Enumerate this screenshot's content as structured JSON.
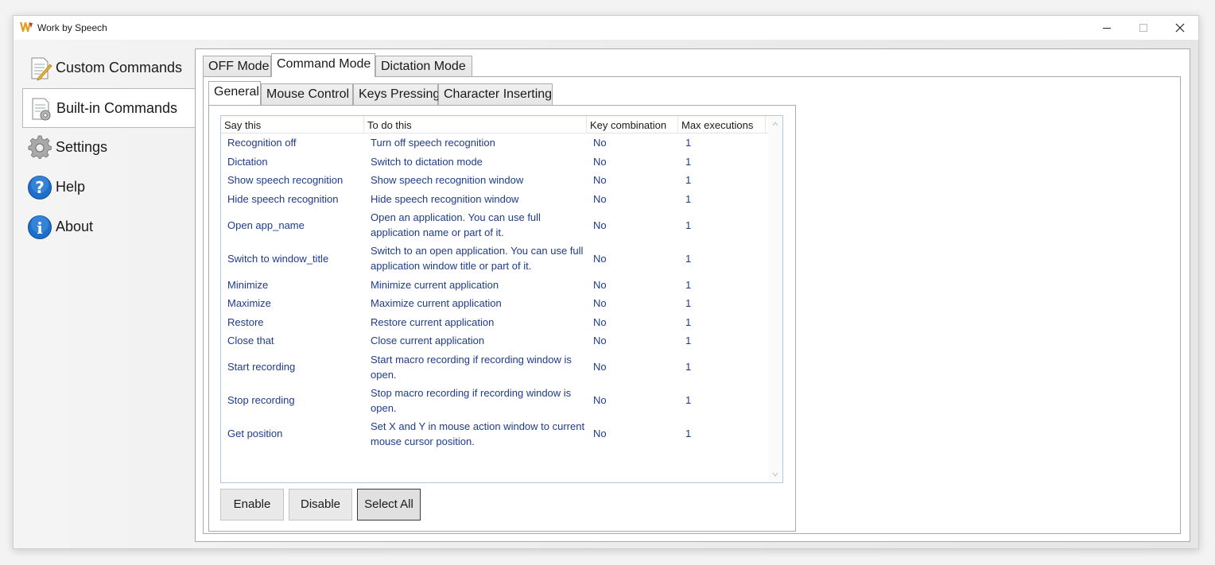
{
  "window": {
    "title": "Work by Speech"
  },
  "sidebar": {
    "items": [
      {
        "label": "Custom Commands",
        "icon": "document-pencil-icon"
      },
      {
        "label": "Built-in Commands",
        "icon": "document-gear-icon",
        "selected": true
      },
      {
        "label": "Settings",
        "icon": "gear-icon"
      },
      {
        "label": "Help",
        "icon": "help-icon"
      },
      {
        "label": "About",
        "icon": "info-icon"
      }
    ]
  },
  "mode_tabs": [
    {
      "label": "OFF Mode"
    },
    {
      "label": "Command Mode",
      "active": true
    },
    {
      "label": "Dictation Mode"
    }
  ],
  "sub_tabs": [
    {
      "label": "General",
      "active": true
    },
    {
      "label": "Mouse Control"
    },
    {
      "label": "Keys Pressing"
    },
    {
      "label": "Character Inserting"
    }
  ],
  "table": {
    "columns": [
      "Say this",
      "To do this",
      "Key combination",
      "Max executions"
    ],
    "rows": [
      {
        "say": "Recognition off",
        "do": "Turn off speech recognition",
        "key": "No",
        "max": "1"
      },
      {
        "say": "Dictation",
        "do": "Switch to dictation mode",
        "key": "No",
        "max": "1"
      },
      {
        "say": "Show speech recognition",
        "do": "Show speech recognition window",
        "key": "No",
        "max": "1"
      },
      {
        "say": "Hide speech recognition",
        "do": "Hide speech recognition window",
        "key": "No",
        "max": "1"
      },
      {
        "say": "Open app_name",
        "do": "Open an application. You can use full application name or part of it.",
        "key": "No",
        "max": "1"
      },
      {
        "say": "Switch to window_title",
        "do": "Switch to an open application. You can use full application window title or part of it.",
        "key": "No",
        "max": "1"
      },
      {
        "say": "Minimize",
        "do": "Minimize current application",
        "key": "No",
        "max": "1"
      },
      {
        "say": "Maximize",
        "do": "Maximize current application",
        "key": "No",
        "max": "1"
      },
      {
        "say": "Restore",
        "do": "Restore current application",
        "key": "No",
        "max": "1"
      },
      {
        "say": "Close that",
        "do": "Close current application",
        "key": "No",
        "max": "1"
      },
      {
        "say": "Start recording",
        "do": "Start macro recording if recording window is open.",
        "key": "No",
        "max": "1"
      },
      {
        "say": "Stop recording",
        "do": "Stop macro recording if recording window is open.",
        "key": "No",
        "max": "1"
      },
      {
        "say": "Get position",
        "do": "Set X and Y in mouse action window to current mouse cursor position.",
        "key": "No",
        "max": "1"
      }
    ]
  },
  "buttons": {
    "enable": "Enable",
    "disable": "Disable",
    "select_all": "Select All"
  }
}
